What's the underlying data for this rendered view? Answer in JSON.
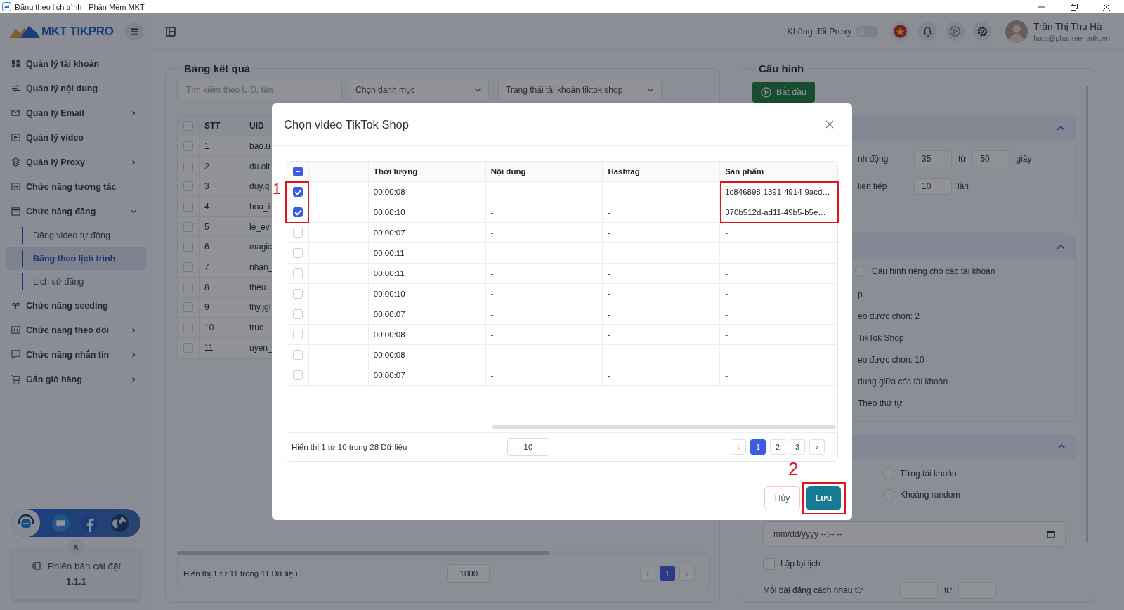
{
  "title_bar": {
    "title": "Đăng theo lịch trình - Phần Mềm MKT"
  },
  "sidebar": {
    "logo": "MKT TIKPRO",
    "items": [
      {
        "label": "Quản lý tài khoản",
        "submenu": false
      },
      {
        "label": "Quản lý nội dung",
        "submenu": false
      },
      {
        "label": "Quản lý Email",
        "submenu": true,
        "expanded": false
      },
      {
        "label": "Quản lý video",
        "submenu": false
      },
      {
        "label": "Quản lý Proxy",
        "submenu": true,
        "expanded": false
      },
      {
        "label": "Chức năng tương tác",
        "submenu": false
      },
      {
        "label": "Chức năng đăng",
        "submenu": true,
        "expanded": true,
        "children": [
          {
            "label": "Đăng video tự động",
            "selected": false
          },
          {
            "label": "Đăng theo lịch trình",
            "selected": true
          },
          {
            "label": "Lịch sử đăng",
            "selected": false
          }
        ]
      },
      {
        "label": "Chức năng seeding",
        "submenu": false
      },
      {
        "label": "Chức năng theo dõi",
        "submenu": true,
        "expanded": false
      },
      {
        "label": "Chức năng nhắn tin",
        "submenu": true,
        "expanded": false
      },
      {
        "label": "Gắn giỏ hàng",
        "submenu": true,
        "expanded": false
      }
    ],
    "version_card": {
      "label": "Phiên bản cài đặt",
      "version": "1.1.1"
    }
  },
  "top_bar": {
    "proxy_label": "Không đổi Proxy",
    "proxy_on": false,
    "user_name": "Trần Thị Thu Hà",
    "user_email": "hattt@phanmemmkt.vn"
  },
  "results": {
    "title": "Bảng kết quả",
    "search_placeholder": "Tìm kiếm theo UID, tên",
    "filters": [
      "Chọn danh mục",
      "Trạng thái tài khoản tiktok shop"
    ],
    "select_all": false,
    "columns": [
      "STT",
      "UID"
    ],
    "rows": [
      {
        "stt": "1",
        "uid": "bao.u",
        "selected": false
      },
      {
        "stt": "2",
        "uid": "du.olt",
        "selected": false
      },
      {
        "stt": "3",
        "uid": "duy.q",
        "selected": false
      },
      {
        "stt": "4",
        "uid": "hoa_i",
        "selected": false
      },
      {
        "stt": "5",
        "uid": "le_ev",
        "selected": false
      },
      {
        "stt": "6",
        "uid": "magic",
        "selected": false
      },
      {
        "stt": "7",
        "uid": "nhan_",
        "selected": false
      },
      {
        "stt": "8",
        "uid": "theu_",
        "selected": false
      },
      {
        "stt": "9",
        "uid": "thy.jgl",
        "selected": false
      },
      {
        "stt": "10",
        "uid": "truc_",
        "selected": false
      },
      {
        "stt": "11",
        "uid": "uyen_",
        "selected": false
      }
    ],
    "summary": "Hiển thị 1 từ 11 trong 11 Dữ liệu",
    "page_size": "1000",
    "prev": "‹",
    "next": "›",
    "pages": [
      {
        "label": "1",
        "selected": true
      }
    ]
  },
  "config": {
    "title": "Cấu hình",
    "start_button": "Bắt đầu",
    "sections": [
      {
        "expanded": true,
        "rows": [
          {
            "kind": "range",
            "label": "nh động",
            "from": "35",
            "between": "từ",
            "to": "50",
            "unit": "giây"
          },
          {
            "kind": "number",
            "label": "liên tiếp",
            "value": "10",
            "unit": "lần"
          }
        ]
      },
      {
        "expanded": true,
        "rows": [
          {
            "kind": "radio",
            "label": "Cấu hình riêng cho các tài khoản",
            "selected": false
          },
          {
            "kind": "text",
            "label": "p"
          },
          {
            "kind": "text",
            "label": "eo được chọn: 2"
          },
          {
            "kind": "text",
            "label": "TikTok Shop"
          },
          {
            "kind": "text",
            "label": "eo được chọn: 10"
          },
          {
            "kind": "text",
            "label": "dung giữa các tài khoản"
          },
          {
            "kind": "text",
            "label": "Theo thứ tự"
          }
        ]
      },
      {
        "expanded": true,
        "rows": [
          {
            "kind": "option",
            "label": "Từng tài khoản",
            "selected": false
          },
          {
            "kind": "option",
            "label": "Khoảng random",
            "selected": false
          },
          {
            "kind": "datetime",
            "placeholder": "mm/dd/yyyy --:-- --"
          },
          {
            "kind": "checkbox",
            "label": "Lặp lại lịch",
            "checked": false
          },
          {
            "kind": "range",
            "label": "Mỗi bài đăng cách nhau từ",
            "between": "từ"
          }
        ]
      }
    ]
  },
  "modal": {
    "title": "Chọn video TikTok Shop",
    "select_all_partial": true,
    "columns": [
      "Thời lượng",
      "Nội dung",
      "Hashtag",
      "Sản phẩm"
    ],
    "rows": [
      {
        "selected": true,
        "duration": "00:00:08",
        "content": "-",
        "hashtag": "-",
        "product": "1c846898-1391-4914-9acd…"
      },
      {
        "selected": true,
        "duration": "00:00:10",
        "content": "-",
        "hashtag": "-",
        "product": "370b512d-ad11-49b5-b5e…"
      },
      {
        "selected": false,
        "duration": "00:00:07",
        "content": "-",
        "hashtag": "-",
        "product": "-"
      },
      {
        "selected": false,
        "duration": "00:00:11",
        "content": "-",
        "hashtag": "-",
        "product": "-"
      },
      {
        "selected": false,
        "duration": "00:00:11",
        "content": "-",
        "hashtag": "-",
        "product": "-"
      },
      {
        "selected": false,
        "duration": "00:00:10",
        "content": "-",
        "hashtag": "-",
        "product": "-"
      },
      {
        "selected": false,
        "duration": "00:00:07",
        "content": "-",
        "hashtag": "-",
        "product": "-"
      },
      {
        "selected": false,
        "duration": "00:00:08",
        "content": "-",
        "hashtag": "-",
        "product": "-"
      },
      {
        "selected": false,
        "duration": "00:00:08",
        "content": "-",
        "hashtag": "-",
        "product": "-"
      },
      {
        "selected": false,
        "duration": "00:00:07",
        "content": "-",
        "hashtag": "-",
        "product": "-"
      }
    ],
    "summary": "Hiển thị 1 từ 10 trong 28 Dữ liệu",
    "page_size": "10",
    "prev": "‹",
    "next": "›",
    "pages": [
      {
        "label": "1",
        "selected": true
      },
      {
        "label": "2",
        "selected": false
      },
      {
        "label": "3",
        "selected": false
      }
    ],
    "cancel_button": "Hủy",
    "save_button": "Lưu",
    "selection_callout_label": "1",
    "product_callout": true,
    "save_callout_label": "2"
  }
}
